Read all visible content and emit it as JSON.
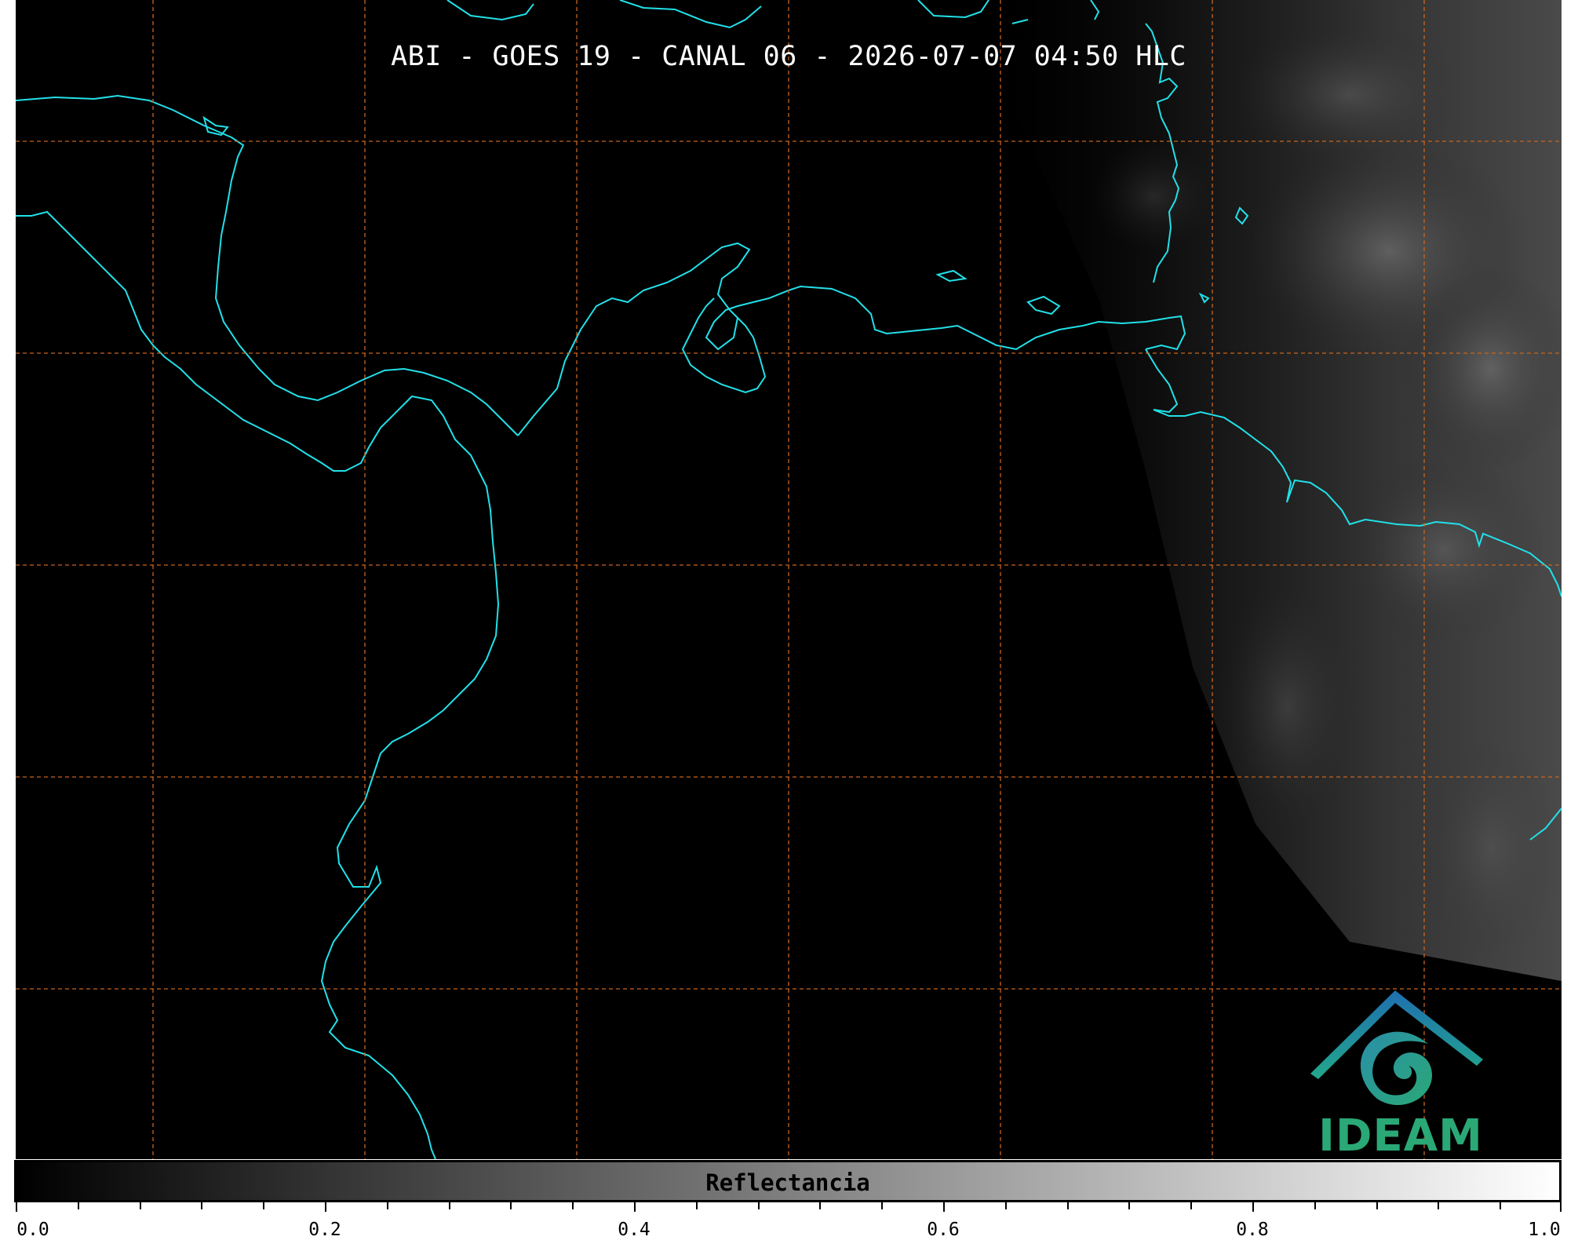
{
  "map": {
    "title": "ABI - GOES 19 - CANAL 06 - 2026-07-07 04:50 HLC",
    "background_color": "#000000",
    "coastline_color": "#22e0e8",
    "gridline_color": "#c8641e",
    "gridline_style": "dashed",
    "cloud_region": "east"
  },
  "logo": {
    "text": "IDEAM",
    "colors": [
      "#1f6fb0",
      "#22a88a",
      "#2aa876"
    ]
  },
  "colorbar": {
    "label": "Reflectancia",
    "range": [
      0.0,
      1.0
    ],
    "colormap": "gray",
    "tick_labels": [
      "0.0",
      "0.2",
      "0.4",
      "0.6",
      "0.8",
      "1.0"
    ],
    "minor_ticks_per_major": 4
  }
}
